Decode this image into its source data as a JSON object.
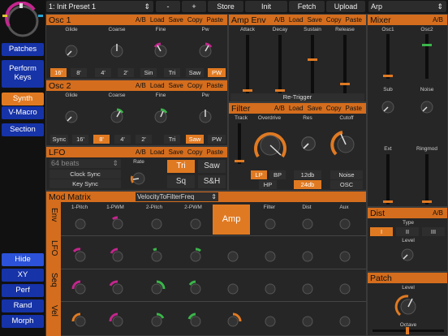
{
  "preset": {
    "name": "1: Init Preset 1",
    "arrows": "⇕"
  },
  "top_buttons": [
    "-",
    "+",
    "Store",
    "Init",
    "Fetch",
    "Upload"
  ],
  "arp": {
    "label": "Arp",
    "arrows": "⇕"
  },
  "nav": [
    "Patches",
    "Perform Keys",
    "Synth",
    "V-Macro",
    "Section"
  ],
  "nav_bottom": [
    "Hide",
    "XY",
    "Perf",
    "Rand",
    "Morph"
  ],
  "controls": {
    "ab": "A/B",
    "load": "Load",
    "save": "Save",
    "copy": "Copy",
    "paste": "Paste"
  },
  "osc1": {
    "title": "Osc 1",
    "knobs": [
      "Glide",
      "Coarse",
      "Fine",
      "Pw"
    ],
    "segs": [
      "16'",
      "8'",
      "4'",
      "2'",
      "Sin",
      "Tri",
      "Saw",
      "PW"
    ]
  },
  "osc2": {
    "title": "Osc 2",
    "knobs": [
      "Glide",
      "Coarse",
      "Fine",
      "Pw"
    ],
    "segs": [
      "Sync",
      "16'",
      "8'",
      "4'",
      "2'",
      "Tri",
      "Saw",
      "PW"
    ]
  },
  "ampenv": {
    "title": "Amp Env",
    "sliders": [
      "Attack",
      "Decay",
      "Sustain",
      "Release"
    ],
    "retrig": "Re-Trigger"
  },
  "filter": {
    "title": "Filter",
    "knobs": [
      "Track",
      "Overdrive",
      "Res",
      "Cutoff"
    ],
    "modes": [
      "LP",
      "BP",
      "HP"
    ],
    "slopes": [
      "12db",
      "24db"
    ],
    "srcs": [
      "Noise",
      "OSC"
    ]
  },
  "lfo": {
    "title": "LFO",
    "beats": "64 beats",
    "beats_arrows": "⇕",
    "clock": "Clock Sync",
    "key": "Key Sync",
    "rate": "Rate",
    "waves": [
      "Tri",
      "Saw",
      "Sq",
      "S&H"
    ]
  },
  "mixer": {
    "title": "Mixer",
    "labels": [
      "Osc1",
      "Osc2",
      "Sub",
      "Noise",
      "Ext",
      "Ringmod"
    ]
  },
  "dist": {
    "title": "Dist",
    "type": "Type",
    "opts": [
      "I",
      "II",
      "III"
    ],
    "level": "Level"
  },
  "patch": {
    "title": "Patch",
    "level": "Level",
    "octave": "Octave"
  },
  "modmatrix": {
    "title": "Mod Matrix",
    "preset": "VelocityToFilterFreq",
    "preset_arrows": "⇕",
    "rows": [
      "Env",
      "LFO",
      "Seq",
      "Vel"
    ],
    "cols": [
      "1-Pitch",
      "1-PWM",
      "2-Pitch",
      "2-PWM",
      "Amp",
      "Filter",
      "Dist",
      "Aux"
    ]
  }
}
